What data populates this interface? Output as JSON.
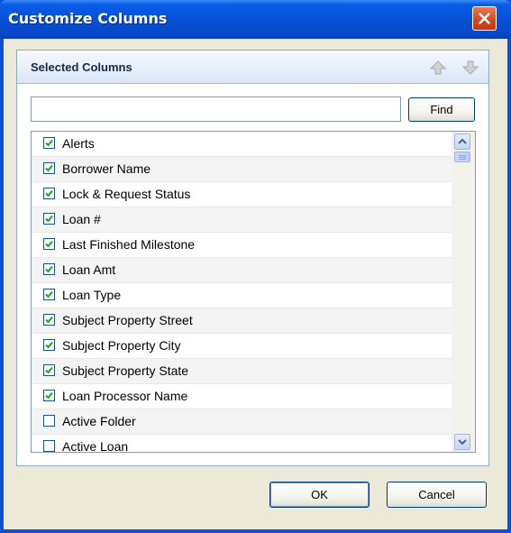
{
  "window": {
    "title": "Customize Columns"
  },
  "group": {
    "title": "Selected Columns"
  },
  "search": {
    "value": "",
    "placeholder": ""
  },
  "find_label": "Find",
  "columns": [
    {
      "label": "Alerts",
      "checked": true
    },
    {
      "label": "Borrower Name",
      "checked": true
    },
    {
      "label": "Lock & Request Status",
      "checked": true
    },
    {
      "label": "Loan #",
      "checked": true
    },
    {
      "label": "Last Finished Milestone",
      "checked": true
    },
    {
      "label": "Loan Amt",
      "checked": true
    },
    {
      "label": "Loan Type",
      "checked": true
    },
    {
      "label": "Subject Property Street",
      "checked": true
    },
    {
      "label": "Subject Property City",
      "checked": true
    },
    {
      "label": "Subject Property State",
      "checked": true
    },
    {
      "label": "Loan Processor Name",
      "checked": true
    },
    {
      "label": "Active Folder",
      "checked": false
    },
    {
      "label": "Active Loan",
      "checked": false
    }
  ],
  "buttons": {
    "ok": "OK",
    "cancel": "Cancel"
  },
  "colors": {
    "titlebar": "#0551d6",
    "client": "#ece9d8",
    "check": "#21a121"
  },
  "icons": {
    "close": "close-icon",
    "move_up": "arrow-up-icon",
    "move_down": "arrow-down-icon"
  }
}
